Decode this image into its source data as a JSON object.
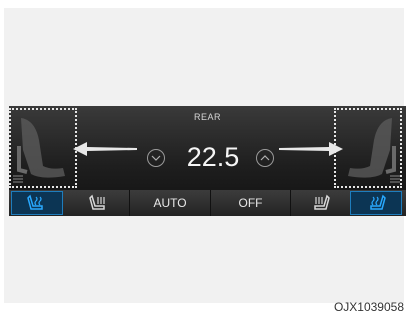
{
  "header": {
    "zone_label": "REAR"
  },
  "temperature": {
    "value": "22.5"
  },
  "buttons": {
    "auto_label": "AUTO",
    "off_label": "OFF"
  },
  "icons": {
    "temp_down": "chevron-down-icon",
    "temp_up": "chevron-up-icon",
    "seat_heat": "seat-heat-icon",
    "seat_vent": "seat-vent-icon"
  },
  "colors": {
    "active_accent": "#1e7dbd",
    "active_icon": "#29a9ff"
  },
  "caption": "OJX1039058"
}
